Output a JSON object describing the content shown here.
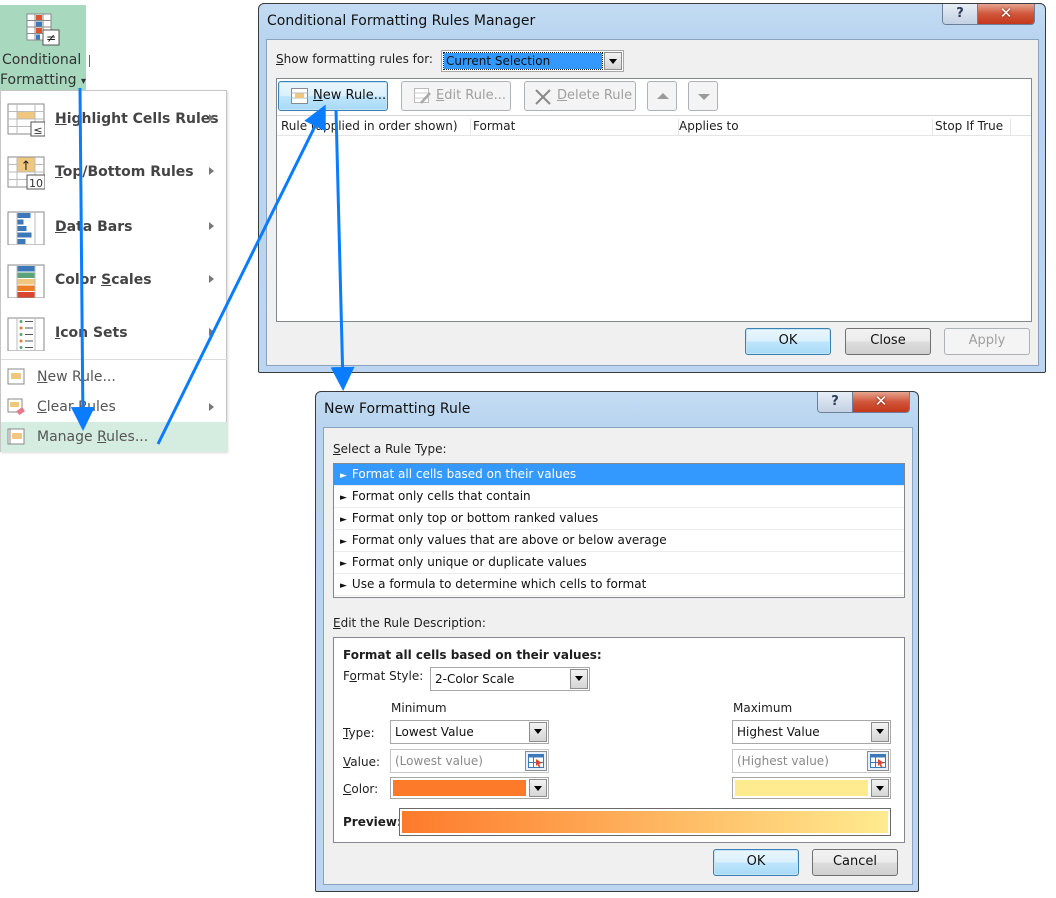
{
  "ribbon": {
    "button_line1": "Conditional",
    "button_line2": "Formatting",
    "dropdown_glyph": "▾",
    "icon": "conditional-formatting-icon"
  },
  "menu": {
    "big_items": [
      {
        "label_u": "H",
        "label_rest": "ighlight Cells Rules",
        "icon": "highlight-cells-icon",
        "has_submenu": true
      },
      {
        "label_u": "T",
        "label_rest": "op/Bottom Rules",
        "icon": "top-bottom-icon",
        "has_submenu": true,
        "icon_text": "10"
      },
      {
        "label_u": "D",
        "label_rest": "ata Bars",
        "icon": "data-bars-icon",
        "has_submenu": true
      },
      {
        "label_pre": "Color ",
        "label_u": "S",
        "label_rest": "cales",
        "icon": "color-scales-icon",
        "has_submenu": true
      },
      {
        "label_u": "I",
        "label_rest": "con Sets",
        "icon": "icon-sets-icon",
        "has_submenu": true
      }
    ],
    "small_items": [
      {
        "label_u": "N",
        "label_rest": "ew Rule...",
        "icon": "new-rule-icon",
        "has_submenu": false
      },
      {
        "label_u": "C",
        "label_rest": "lear Rules",
        "icon": "clear-rules-icon",
        "has_submenu": true
      },
      {
        "label_pre": "Manage ",
        "label_u": "R",
        "label_rest": "ules...",
        "icon": "manage-rules-icon",
        "has_submenu": false,
        "highlighted": true
      }
    ]
  },
  "rules_manager": {
    "title": "Conditional Formatting Rules Manager",
    "help_glyph": "?",
    "close_glyph": "✕",
    "show_label_u": "S",
    "show_label_rest": "how formatting rules for:",
    "show_value": "Current Selection",
    "toolbar": {
      "new_rule_u": "N",
      "new_rule_rest": "ew Rule...",
      "edit_rule_u": "E",
      "edit_rule_rest": "dit Rule...",
      "delete_rule_u": "D",
      "delete_rule_rest": "elete Rule"
    },
    "columns": [
      "Rule (applied in order shown)",
      "Format",
      "Applies to",
      "Stop If True"
    ],
    "rows": [],
    "buttons": {
      "ok": "OK",
      "close": "Close",
      "apply": "Apply"
    }
  },
  "new_rule_dialog": {
    "title": "New Formatting Rule",
    "help_glyph": "?",
    "close_glyph": "✕",
    "select_type_u": "S",
    "select_type_rest": "elect a Rule Type:",
    "rule_types": [
      "Format all cells based on their values",
      "Format only cells that contain",
      "Format only top or bottom ranked values",
      "Format only values that are above or below average",
      "Format only unique or duplicate values",
      "Use a formula to determine which cells to format"
    ],
    "selected_rule_index": 0,
    "bullet_glyph": "►",
    "edit_desc_u": "E",
    "edit_desc_rest": "dit the Rule Description:",
    "desc_heading": "Format all cells based on their values:",
    "format_style_pre": "F",
    "format_style_u": "o",
    "format_style_rest": "rmat Style:",
    "format_style_value": "2-Color Scale",
    "minimum_label": "Minimum",
    "maximum_label": "Maximum",
    "type_u": "T",
    "type_rest": "ype:",
    "value_u": "V",
    "value_rest": "alue:",
    "color_u": "C",
    "color_rest": "olor:",
    "min_type": "Lowest Value",
    "max_type": "Highest Value",
    "min_value_placeholder": "(Lowest value)",
    "max_value_placeholder": "(Highest value)",
    "min_color": "#fd7a2b",
    "max_color": "#ffeb8f",
    "preview_label": "Preview:",
    "buttons": {
      "ok": "OK",
      "cancel": "Cancel"
    }
  },
  "colors": {
    "annotation_arrow": "#0a7cff",
    "selection_blue": "#3399ff",
    "ribbon_highlight": "#a8d8bd",
    "menu_highlight": "#d4ede0"
  }
}
